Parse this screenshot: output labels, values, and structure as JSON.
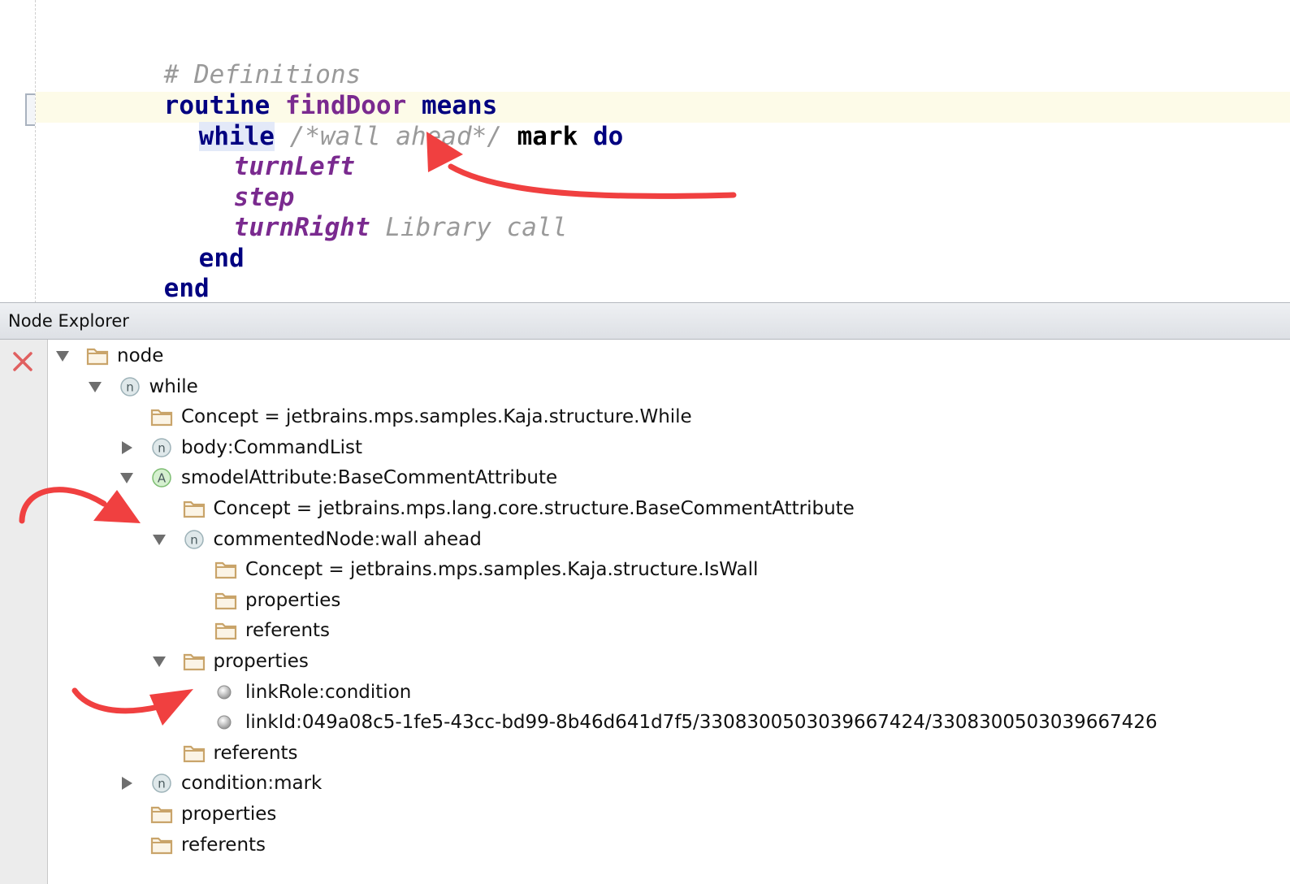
{
  "editor": {
    "comment_line": "# Definitions",
    "routine_kw": "routine",
    "routine_name": "findDoor",
    "means_kw": "means",
    "while_kw": "while",
    "while_comment": "/*wall ahead*/",
    "mark_kw": "mark",
    "do_kw": "do",
    "call1": "turnLeft",
    "call2": "step",
    "call3": "turnRight",
    "call3_comment": "Library call",
    "end_inner": "end",
    "end_outer": "end"
  },
  "panel": {
    "title": "Node Explorer"
  },
  "tree": [
    {
      "label": "node",
      "icon": "folder-icon",
      "expander": "expanded"
    },
    {
      "label": "while",
      "icon": "node-icon",
      "icon_letter": "n",
      "expander": "expanded"
    },
    {
      "label": "Concept = jetbrains.mps.samples.Kaja.structure.While",
      "icon": "folder-icon",
      "expander": "none"
    },
    {
      "label": "body",
      "value": "CommandList",
      "icon": "node-icon",
      "icon_letter": "n",
      "expander": "collapsed"
    },
    {
      "label": "smodelAttribute",
      "value": "BaseCommentAttribute",
      "icon": "attribute-icon",
      "icon_letter": "A",
      "expander": "expanded"
    },
    {
      "label": "Concept = jetbrains.mps.lang.core.structure.BaseCommentAttribute",
      "icon": "folder-icon",
      "expander": "none"
    },
    {
      "label": "commentedNode",
      "value": "wall ahead",
      "icon": "node-icon",
      "icon_letter": "n",
      "expander": "expanded"
    },
    {
      "label": "Concept = jetbrains.mps.samples.Kaja.structure.IsWall",
      "icon": "folder-icon",
      "expander": "none"
    },
    {
      "label": "properties",
      "icon": "folder-icon",
      "expander": "none"
    },
    {
      "label": "referents",
      "icon": "folder-icon",
      "expander": "none"
    },
    {
      "label": "properties",
      "icon": "folder-icon",
      "expander": "expanded"
    },
    {
      "label": "linkRole",
      "value": "condition",
      "icon": "property-icon",
      "expander": "none"
    },
    {
      "label": "linkId",
      "value": "049a08c5-1fe5-43cc-bd99-8b46d641d7f5/3308300503039667424/3308300503039667426",
      "icon": "property-icon",
      "expander": "none"
    },
    {
      "label": "referents",
      "icon": "folder-icon",
      "expander": "none"
    },
    {
      "label": "condition",
      "value": "mark",
      "icon": "node-icon",
      "icon_letter": "n",
      "expander": "collapsed"
    },
    {
      "label": "properties",
      "icon": "folder-icon",
      "expander": "none"
    },
    {
      "label": "referents",
      "icon": "folder-icon",
      "expander": "none"
    }
  ],
  "separator": " : ",
  "colors": {
    "keyword": "#000080",
    "function": "#7a2a8f",
    "comment": "#9a9a9a",
    "annotation_arrow": "#f04040",
    "folder": "#c9a46a"
  }
}
